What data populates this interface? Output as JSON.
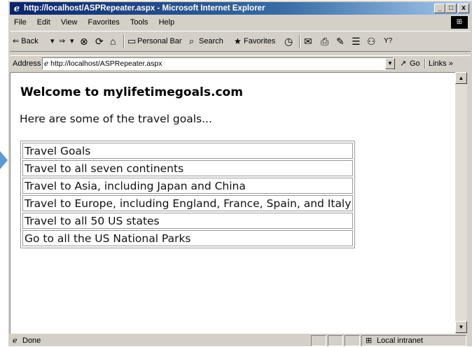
{
  "window": {
    "title": "http://localhost/ASPRepeater.aspx - Microsoft Internet Explorer",
    "controls": [
      "_",
      "□",
      "x"
    ]
  },
  "menu": [
    "File",
    "Edit",
    "View",
    "Favorites",
    "Tools",
    "Help"
  ],
  "toolbar": {
    "back": "⇐ Back",
    "back_drop": "▾",
    "forward": "⇒",
    "forward_drop": "▾",
    "stop": "⊗",
    "refresh": "⟳",
    "home": "⌂",
    "personal_bar": "Personal Bar",
    "search": "Search",
    "favorites": "Favorites",
    "history": "◷",
    "mail": "✉",
    "print": "⎙",
    "edit": "✎",
    "discuss": "☰",
    "messenger": "⚇",
    "more": "Y?"
  },
  "address": {
    "label": "Address",
    "value": "http://localhost/ASPRepeater.aspx",
    "go": "Go",
    "links": "Links »"
  },
  "page": {
    "heading": "Welcome to mylifetimegoals.com",
    "intro": "Here are some of the travel goals...",
    "table_header": "Travel Goals",
    "goals": [
      "Travel to all seven continents",
      "Travel to Asia, including Japan and China",
      "Travel to Europe, including England, France, Spain, and Italy",
      "Travel to all 50 US states",
      "Go to all the US National Parks"
    ]
  },
  "status": {
    "text": "Done",
    "zone": "Local intranet"
  }
}
